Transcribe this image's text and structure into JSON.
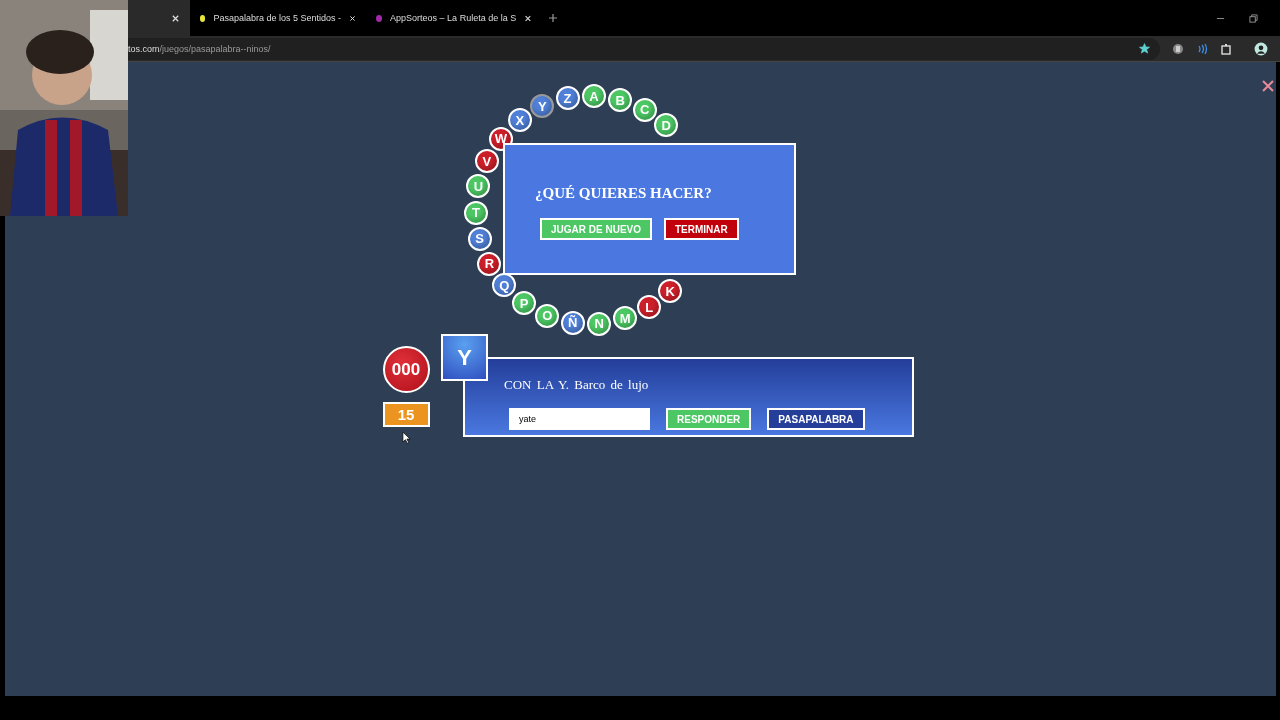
{
  "browser": {
    "tabs": [
      {
        "selected": true
      },
      {
        "title": "Pasapalabra de los 5 Sentidos -",
        "selected": false,
        "color": "#e6e63a"
      },
      {
        "title": "AppSorteos – La Ruleta de la S",
        "selected": false,
        "color": "#a02aa8"
      }
    ],
    "address": {
      "host": "tos.com",
      "path": "/juegos/pasapalabra--ninos/"
    },
    "bookmarked": true
  },
  "wheel": [
    {
      "letter": "X",
      "color": "#4f7fd6",
      "current": false
    },
    {
      "letter": "Y",
      "color": "#4f7fd6",
      "current": true
    },
    {
      "letter": "Z",
      "color": "#4f7fd6",
      "current": false
    },
    {
      "letter": "A",
      "color": "#4cc764",
      "current": false
    },
    {
      "letter": "B",
      "color": "#4cc764",
      "current": false
    },
    {
      "letter": "C",
      "color": "#4cc764",
      "current": false
    },
    {
      "letter": "D",
      "color": "#4cc764",
      "current": false
    },
    {
      "letter": "W",
      "color": "#cc1f2a",
      "current": false
    },
    {
      "letter": "V",
      "color": "#cc1f2a",
      "current": false
    },
    {
      "letter": "U",
      "color": "#4cc764",
      "current": false
    },
    {
      "letter": "T",
      "color": "#4cc764",
      "current": false
    },
    {
      "letter": "S",
      "color": "#4f7fd6",
      "current": false
    },
    {
      "letter": "R",
      "color": "#cc1f2a",
      "current": false
    },
    {
      "letter": "Q",
      "color": "#4f7fd6",
      "current": false
    },
    {
      "letter": "P",
      "color": "#4cc764",
      "current": false
    },
    {
      "letter": "O",
      "color": "#4cc764",
      "current": false
    },
    {
      "letter": "Ñ",
      "color": "#4f7fd6",
      "current": false
    },
    {
      "letter": "N",
      "color": "#4cc764",
      "current": false
    },
    {
      "letter": "M",
      "color": "#4cc764",
      "current": false
    },
    {
      "letter": "L",
      "color": "#cc1f2a",
      "current": false
    },
    {
      "letter": "K",
      "color": "#cc1f2a",
      "current": false
    }
  ],
  "dialog": {
    "title": "¿QUÉ QUIERES HACER?",
    "buttons": [
      {
        "label": "JUGAR DE NUEVO",
        "kind": "primary"
      },
      {
        "label": "TERMINAR",
        "kind": "danger"
      }
    ]
  },
  "score": "000",
  "timer": "15",
  "question": {
    "letter": "Y",
    "text": "CON LA Y. Barco de lujo",
    "answer": "yate",
    "buttons": [
      {
        "label": "RESPONDER",
        "kind": "primary"
      },
      {
        "label": "PASAPALABRA",
        "kind": "secondary"
      }
    ]
  }
}
